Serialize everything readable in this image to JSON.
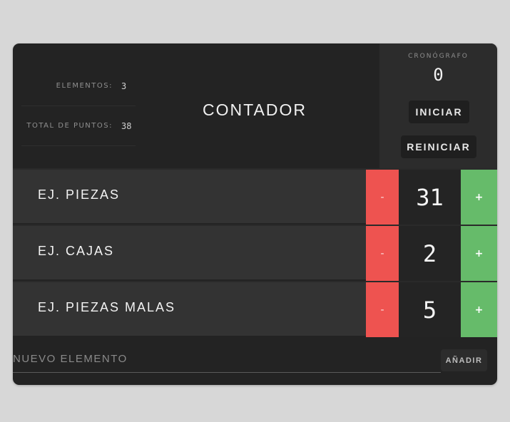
{
  "header": {
    "title": "CONTADOR",
    "stats": [
      {
        "label": "ELEMENTOS:",
        "value": "3"
      },
      {
        "label": "TOTAL DE PUNTOS:",
        "value": "38"
      }
    ]
  },
  "chrono": {
    "label": "CRONÓGRAFO",
    "value": "0",
    "start_label": "INICIAR",
    "reset_label": "REINICIAR"
  },
  "items": [
    {
      "name": "EJ. PIEZAS",
      "count": "31",
      "minus": "-",
      "plus": "+"
    },
    {
      "name": "EJ. CAJAS",
      "count": "2",
      "minus": "-",
      "plus": "+"
    },
    {
      "name": "EJ. PIEZAS MALAS",
      "count": "5",
      "minus": "-",
      "plus": "+"
    }
  ],
  "footer": {
    "placeholder": "NUEVO ELEMENTO",
    "add_label": "AÑADIR"
  },
  "colors": {
    "minus": "#ee5350",
    "plus": "#66bb6a",
    "card": "#232323",
    "row": "#333333"
  }
}
